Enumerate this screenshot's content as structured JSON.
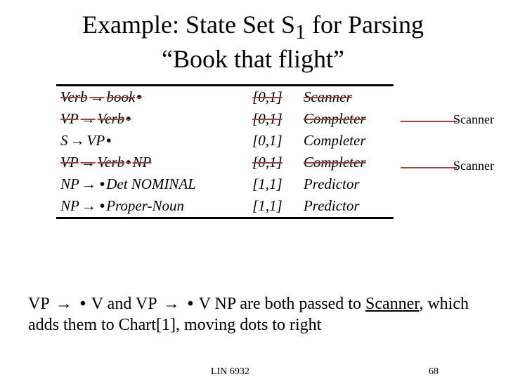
{
  "title_line1": "Example: State Set S",
  "title_sub": "1",
  "title_line1b": " for Parsing",
  "title_line2": "“Book that flight”",
  "rows": [
    {
      "lhs": "Verb",
      "rhs_pre": "book",
      "rhs_post": "",
      "span": "[0,1]",
      "op": "Scanner",
      "strike": true
    },
    {
      "lhs": "VP",
      "rhs_pre": "Verb",
      "rhs_post": "",
      "span": "[0,1]",
      "op": "Completer",
      "strike": true
    },
    {
      "lhs": "S",
      "rhs_pre": "VP",
      "rhs_post": "",
      "span": "[0,1]",
      "op": "Completer",
      "strike": false
    },
    {
      "lhs": "VP",
      "rhs_pre": "Verb",
      "rhs_post": "NP",
      "span": "[0,1]",
      "op": "Completer",
      "strike": true
    },
    {
      "lhs": "NP",
      "rhs_pre": "",
      "rhs_post": "Det NOMINAL",
      "span": "[1,1]",
      "op": "Predictor",
      "strike": false
    },
    {
      "lhs": "NP",
      "rhs_pre": "",
      "rhs_post": "Proper-Noun",
      "span": "[1,1]",
      "op": "Predictor",
      "strike": false
    }
  ],
  "annot1": "Scanner",
  "annot2": "Scanner",
  "caption_a": "VP ",
  "caption_b": " V and VP ",
  "caption_c": " V NP are both passed to ",
  "caption_scanner": "Scanner",
  "caption_d": ", which adds them to Chart[1], moving dots to right",
  "arrow_glyph": "→",
  "dot_glyph": "•",
  "footer_course": "LIN 6932",
  "footer_page": "68"
}
